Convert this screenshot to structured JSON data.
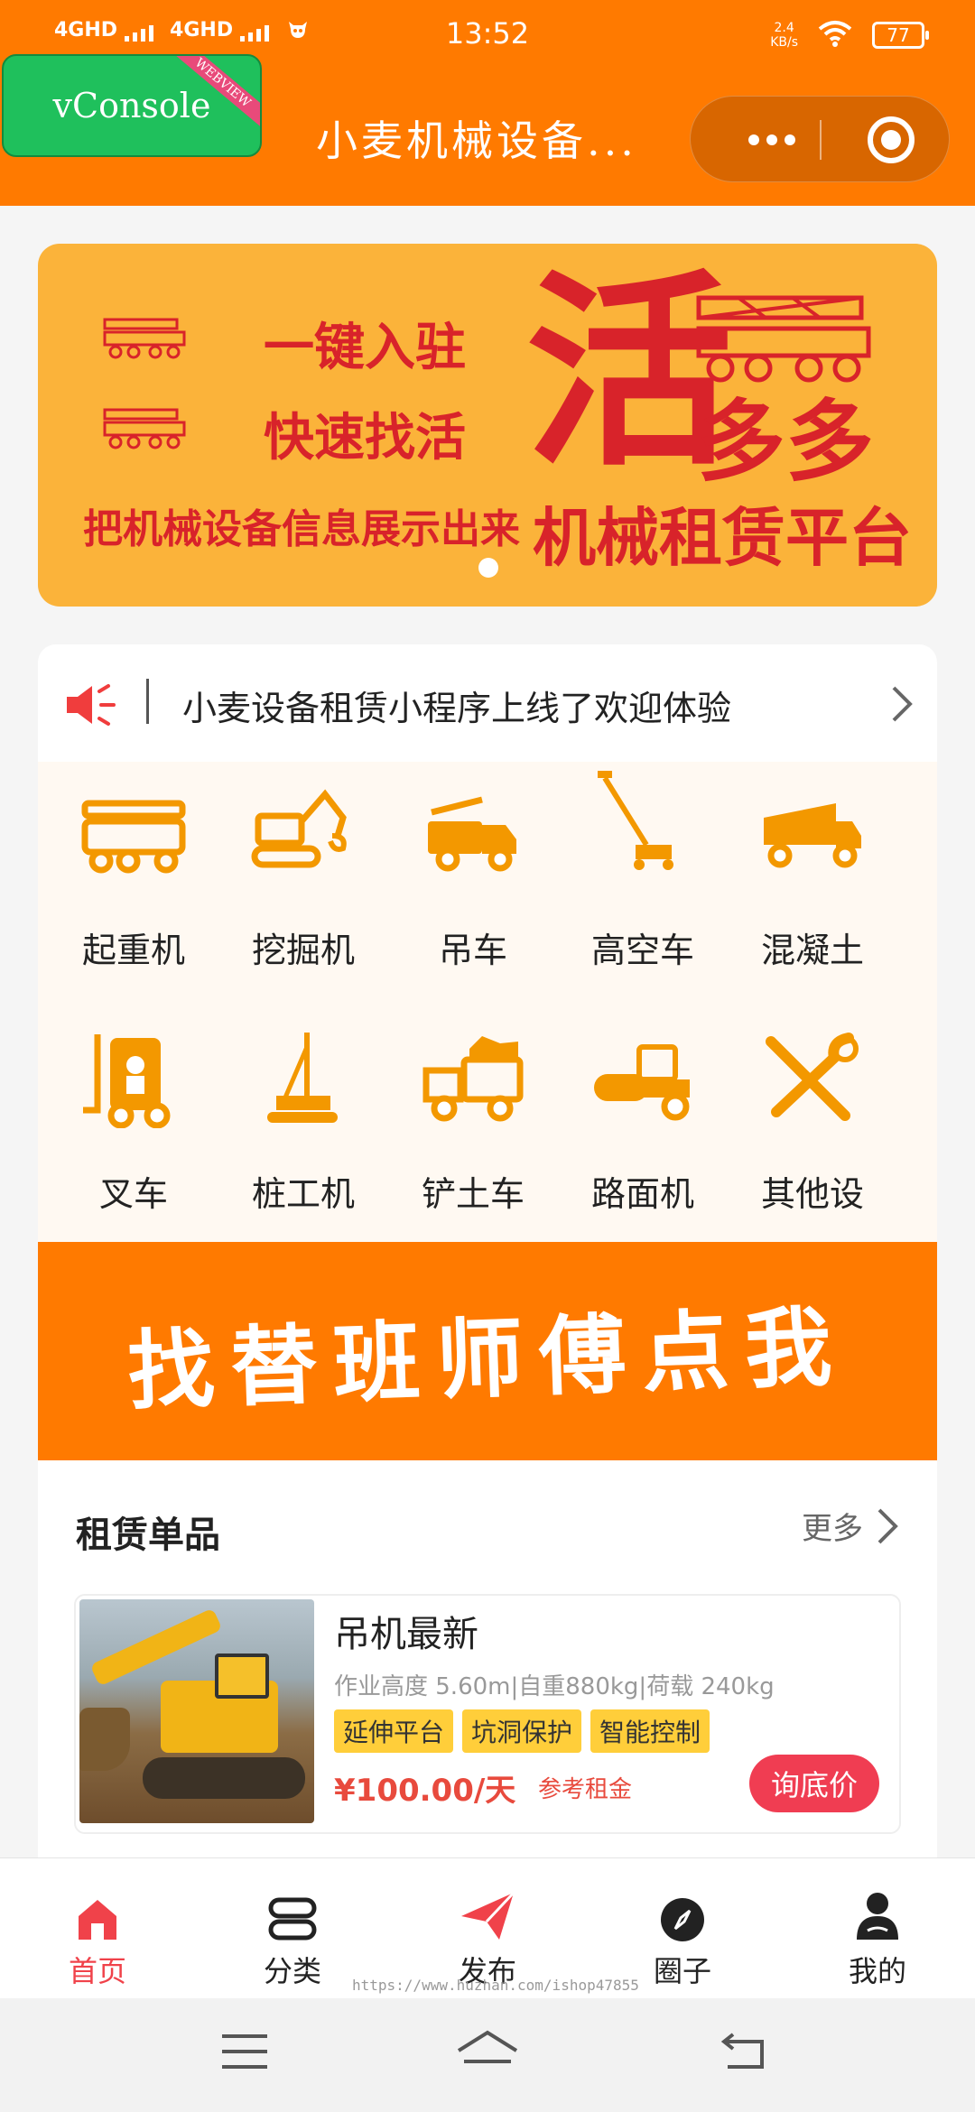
{
  "status_bar": {
    "sim1": "4GHD",
    "sim2": "4GHD",
    "time": "13:52",
    "speed_value": "2.4",
    "speed_unit": "KB/s",
    "battery": "77"
  },
  "debug": {
    "vconsole_label": "vConsole",
    "ribbon": "WEBVIEW"
  },
  "header": {
    "title": "小麦机械设备..."
  },
  "banner": {
    "line1": "一键入驻",
    "line2": "快速找活",
    "line3": "把机械设备信息展示出来",
    "big_char": "活",
    "big_suffix": "多多",
    "platform": "机械租赁平台"
  },
  "notice": {
    "text": "小麦设备租赁小程序上线了欢迎体验"
  },
  "categories": [
    {
      "label": "起重机",
      "icon": "crane-truck-icon"
    },
    {
      "label": "挖掘机",
      "icon": "excavator-icon"
    },
    {
      "label": "吊车",
      "icon": "hoist-truck-icon"
    },
    {
      "label": "高空车",
      "icon": "aerial-lift-icon"
    },
    {
      "label": "混凝土",
      "icon": "concrete-mixer-icon"
    },
    {
      "label": "叉车",
      "icon": "forklift-icon"
    },
    {
      "label": "桩工机",
      "icon": "pile-driver-icon"
    },
    {
      "label": "铲土车",
      "icon": "dump-truck-icon"
    },
    {
      "label": "路面机",
      "icon": "road-roller-icon"
    },
    {
      "label": "其他设",
      "icon": "tools-icon"
    }
  ],
  "promo": {
    "text": "找替班师傅点我"
  },
  "rentals": {
    "heading": "租赁单品",
    "more_label": "更多",
    "items": [
      {
        "title": "吊机最新",
        "spec": "作业高度 5.60m|自重880kg|荷载 240kg",
        "tags": [
          "延伸平台",
          "坑洞保护",
          "智能控制"
        ],
        "price": "¥100.00/天",
        "price_note": "参考租金",
        "action": "询底价"
      }
    ]
  },
  "tabbar": {
    "active_color": "#f0424a",
    "items": [
      {
        "label": "首页",
        "icon": "home-icon"
      },
      {
        "label": "分类",
        "icon": "category-icon"
      },
      {
        "label": "发布",
        "icon": "send-icon"
      },
      {
        "label": "圈子",
        "icon": "compass-icon"
      },
      {
        "label": "我的",
        "icon": "user-icon"
      }
    ]
  },
  "watermark": "https://www.huzhan.com/ishop47855",
  "colors": {
    "brand": "#ff7a00",
    "banner_bg": "#fbb33a",
    "accent_red": "#d8232a",
    "icon_orange": "#f39800"
  }
}
